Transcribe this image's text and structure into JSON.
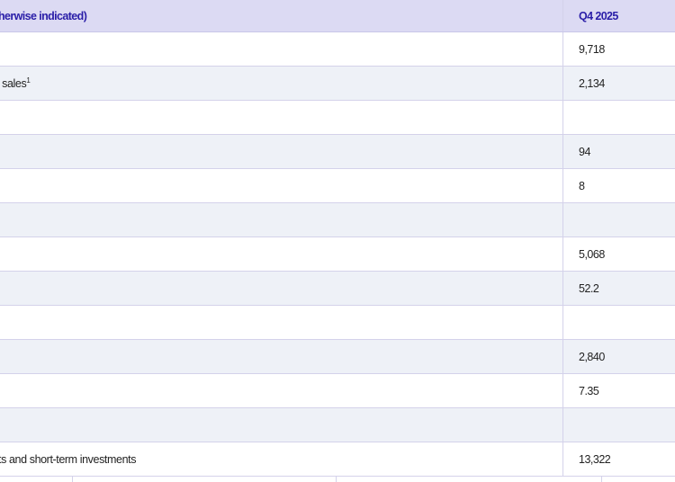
{
  "table": {
    "header": {
      "label": "herwise indicated)",
      "value": "Q4 2025"
    },
    "rows": [
      {
        "label": "",
        "value": "9,718"
      },
      {
        "label": "t sales",
        "sup": "1",
        "value": "2,134"
      },
      {
        "label": "",
        "value": ""
      },
      {
        "label": "",
        "value": "94"
      },
      {
        "label": "",
        "value": "8"
      },
      {
        "label": "",
        "value": ""
      },
      {
        "label": "",
        "value": "5,068"
      },
      {
        "label": "",
        "value": "52.2"
      },
      {
        "label": "",
        "value": ""
      },
      {
        "label": "",
        "value": "2,840"
      },
      {
        "label": "",
        "value": "7.35"
      },
      {
        "label": "",
        "value": ""
      },
      {
        "label": "ts and short-term investments",
        "value": "13,322"
      }
    ]
  }
}
